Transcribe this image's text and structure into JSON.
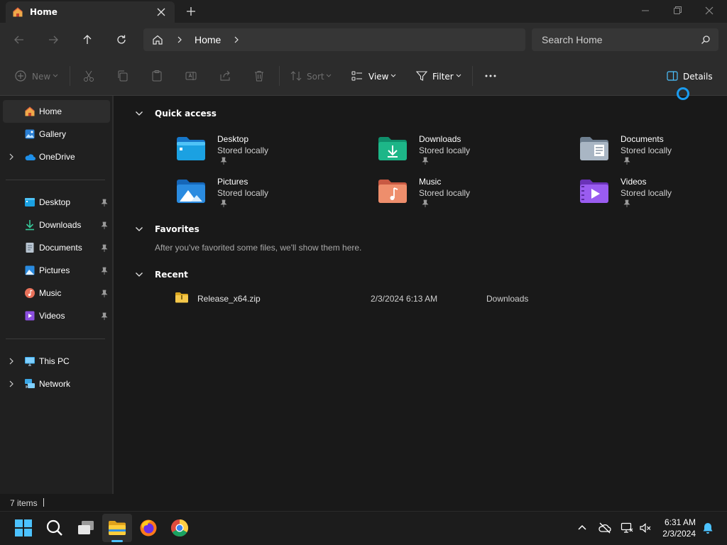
{
  "window": {
    "tab_title": "Home",
    "tab_icon": "home-icon",
    "new_tab_icon": "plus-icon",
    "controls": [
      "minimize-icon",
      "restore-icon",
      "close-icon"
    ]
  },
  "address_bar": {
    "location": "Home",
    "search_placeholder": "Search Home"
  },
  "command_bar": {
    "new_label": "New",
    "sort_label": "Sort",
    "view_label": "View",
    "filter_label": "Filter",
    "details_label": "Details"
  },
  "sidebar": {
    "top_items": [
      {
        "label": "Home",
        "icon": "home-icon",
        "selected": true
      },
      {
        "label": "Gallery",
        "icon": "gallery-icon"
      },
      {
        "label": "OneDrive",
        "icon": "onedrive-icon",
        "expandable": true
      }
    ],
    "pinned_items": [
      {
        "label": "Desktop",
        "icon": "desktop-folder-icon"
      },
      {
        "label": "Downloads",
        "icon": "downloads-icon"
      },
      {
        "label": "Documents",
        "icon": "documents-icon"
      },
      {
        "label": "Pictures",
        "icon": "pictures-icon"
      },
      {
        "label": "Music",
        "icon": "music-icon"
      },
      {
        "label": "Videos",
        "icon": "videos-icon"
      }
    ],
    "bottom_items": [
      {
        "label": "This PC",
        "icon": "this-pc-icon"
      },
      {
        "label": "Network",
        "icon": "network-icon"
      }
    ]
  },
  "main": {
    "quick_access": {
      "title": "Quick access",
      "items": [
        {
          "name": "Desktop",
          "sub": "Stored locally",
          "icon": "desktop-folder-icon"
        },
        {
          "name": "Downloads",
          "sub": "Stored locally",
          "icon": "downloads-folder-icon"
        },
        {
          "name": "Documents",
          "sub": "Stored locally",
          "icon": "documents-folder-icon"
        },
        {
          "name": "Pictures",
          "sub": "Stored locally",
          "icon": "pictures-folder-icon"
        },
        {
          "name": "Music",
          "sub": "Stored locally",
          "icon": "music-folder-icon"
        },
        {
          "name": "Videos",
          "sub": "Stored locally",
          "icon": "videos-folder-icon"
        }
      ]
    },
    "favorites": {
      "title": "Favorites",
      "empty_message": "After you've favorited some files, we'll show them here."
    },
    "recent": {
      "title": "Recent",
      "files": [
        {
          "name": "Release_x64.zip",
          "date": "2/3/2024 6:13 AM",
          "location": "Downloads",
          "icon": "zip-folder-icon"
        }
      ]
    }
  },
  "status_bar": {
    "item_count": "7 items"
  },
  "taskbar": {
    "apps": [
      "windows-start-icon",
      "search-icon",
      "task-view-icon",
      "file-explorer-icon",
      "firefox-icon",
      "chrome-icon"
    ],
    "tray": [
      "chevron-up-icon",
      "cloud-offline-icon",
      "network-icon",
      "volume-muted-icon"
    ],
    "time": "6:31 AM",
    "date": "2/3/2024"
  },
  "colors": {
    "accent": "#4cc2ff",
    "background": "#191919",
    "toolbar": "#2c2c2c",
    "sidebar": "#202020"
  }
}
